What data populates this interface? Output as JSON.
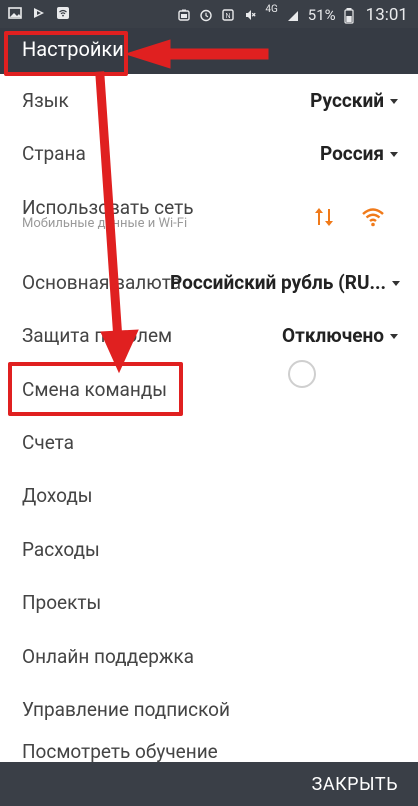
{
  "status_bar": {
    "network": "4G",
    "battery": "51%",
    "time": "13:01"
  },
  "header": {
    "title": "Настройки"
  },
  "settings": {
    "language_label": "Язык",
    "language_value": "Русский",
    "country_label": "Страна",
    "country_value": "Россия",
    "network_label": "Использовать сеть",
    "network_sub": "Мобильные данные и Wi-Fi",
    "currency_label": "Основная валюта",
    "currency_value": "Российский рубль (RU...",
    "password_label": "Защита паролем",
    "password_value": "Отключено",
    "team_change_label": "Смена команды",
    "accounts_label": "Счета",
    "income_label": "Доходы",
    "expenses_label": "Расходы",
    "projects_label": "Проекты",
    "support_label": "Онлайн поддержка",
    "subscription_label": "Управление подпиской",
    "tutorial_label": "Посмотреть обучение"
  },
  "footer": {
    "close_label": "ЗАКРЫТЬ"
  },
  "colors": {
    "accent_orange": "#f07a1a",
    "annotation_red": "#e02020",
    "topbar": "#363b44"
  }
}
